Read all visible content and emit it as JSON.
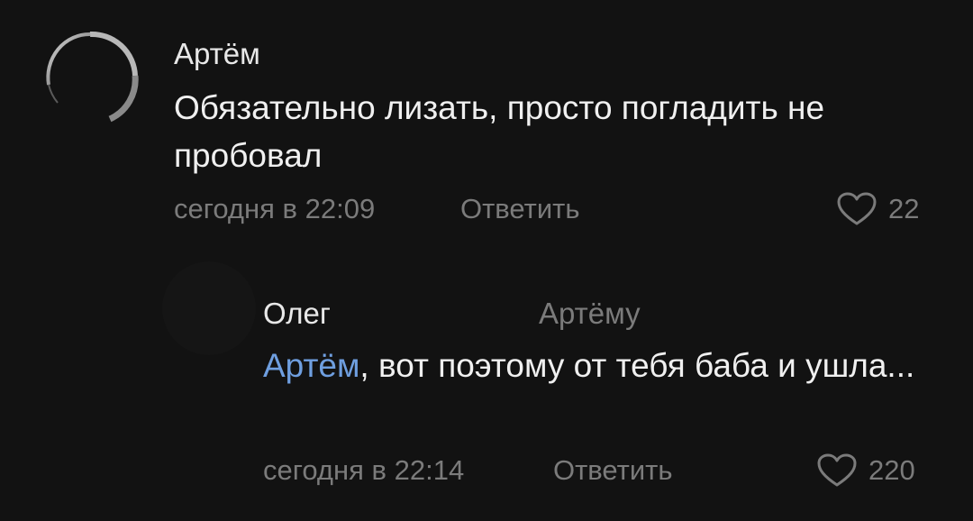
{
  "comments": {
    "main": {
      "author": "Артём",
      "text": "Обязательно лизать, просто погладить не пробовал",
      "time": "сегодня в 22:09",
      "reply_label": "Ответить",
      "likes": "22"
    },
    "reply": {
      "author": "Олег",
      "reply_to": "Артёму",
      "mention": "Артём",
      "text": ", вот поэтому от тебя баба и ушла...",
      "time": "сегодня в 22:14",
      "reply_label": "Ответить",
      "likes": "220"
    }
  },
  "colors": {
    "background": "#121212",
    "text": "#f0f0f0",
    "muted": "#7b7b7b",
    "mention": "#6f9fe0"
  },
  "icons": {
    "like": "heart-outline-icon"
  }
}
